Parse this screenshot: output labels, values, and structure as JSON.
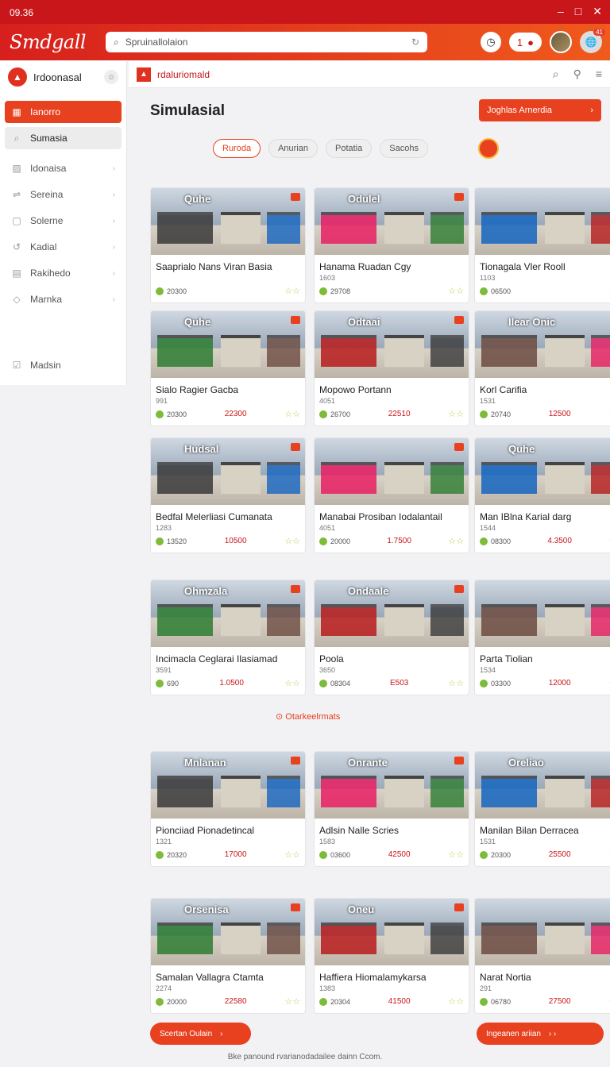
{
  "status": {
    "time": "09.36"
  },
  "app": {
    "name": "Smdgall",
    "search_placeholder": "Spruinallolaion"
  },
  "topbar": {
    "notif_count": "1",
    "avatar_badge": "41"
  },
  "sidebar": {
    "title": "Irdoonasal",
    "items": [
      {
        "label": "Ianorro",
        "icon": "grid-icon"
      },
      {
        "label": "Sumasia",
        "icon": "search-icon"
      },
      {
        "label": "Idonaisa",
        "icon": "image-icon"
      },
      {
        "label": "Sereina",
        "icon": "share-icon"
      },
      {
        "label": "Solerne",
        "icon": "page-icon"
      },
      {
        "label": "Kadial",
        "icon": "refresh-icon"
      },
      {
        "label": "Rakihedo",
        "icon": "calendar-icon"
      },
      {
        "label": "Marnka",
        "icon": "tag-icon"
      },
      {
        "label": "Madsin",
        "icon": "checklist-icon"
      }
    ]
  },
  "main": {
    "tab_title": "rdaluriomald",
    "page_title": "Simulasial",
    "cta_label": "Joghlas Arnerdia",
    "filters": [
      "Ruroda",
      "Anurian",
      "Potatia",
      "Sacohs"
    ],
    "section_label": "Otarkeelrmats",
    "prev_label": "Scertan Oulain",
    "next_label": "Ingeanen ariian",
    "footer": "Bke panound rvarianodadailee dainn Ccom."
  },
  "cards": [
    {
      "name": "Saaprialo Nans Viran Basia",
      "meta": "",
      "stat": "20300",
      "price": "",
      "brand": "Quhe"
    },
    {
      "name": "Hanama Ruadan Cgy",
      "meta": "1603",
      "stat": "29708",
      "price": "",
      "brand": "Odulel"
    },
    {
      "name": "Tionagala Vler Rooll",
      "meta": "1103",
      "stat": "06500",
      "price": "",
      "brand": ""
    },
    {
      "name": "Sialo Ragier Gacba",
      "meta": "991",
      "stat": "20300",
      "price": "22300",
      "brand": "Quhe"
    },
    {
      "name": "Mopowo Portann",
      "meta": "4051",
      "stat": "26700",
      "price": "22510",
      "brand": "Odtaai"
    },
    {
      "name": "Korl Carifia",
      "meta": "1531",
      "stat": "20740",
      "price": "12500",
      "brand": "Ilear Onic"
    },
    {
      "name": "Bedfal Melerliasi Cumanata",
      "meta": "1283",
      "stat": "13520",
      "price": "10500",
      "brand": "Hudsal"
    },
    {
      "name": "Manabai Prosiban Iodalantail",
      "meta": "4051",
      "stat": "20000",
      "price": "1.7500",
      "brand": ""
    },
    {
      "name": "Man IBlna Karial darg",
      "meta": "1544",
      "stat": "08300",
      "price": "4.3500",
      "brand": "Quhe"
    },
    {
      "name": "Incimacla Ceglarai Ilasiamad",
      "meta": "3591",
      "stat": "690",
      "price": "1.0500",
      "brand": "Ohmzala"
    },
    {
      "name": "Poola",
      "meta": "3650",
      "stat": "08304",
      "price": "E503",
      "brand": "Ondaale"
    },
    {
      "name": "Parta Tiolian",
      "meta": "1534",
      "stat": "03300",
      "price": "12000",
      "brand": ""
    },
    {
      "name": "Pionciiad Pionadetincal",
      "meta": "1321",
      "stat": "20320",
      "price": "17000",
      "brand": "Mnlanan"
    },
    {
      "name": "Adlsin Nalle Scries",
      "meta": "1583",
      "stat": "03600",
      "price": "42500",
      "brand": "Onrante"
    },
    {
      "name": "Manilan Bilan Derracea",
      "meta": "1531",
      "stat": "20300",
      "price": "25500",
      "brand": "Oreliao"
    },
    {
      "name": "Samalan Vallagra Ctamta",
      "meta": "2274",
      "stat": "20000",
      "price": "22580",
      "brand": "Orsenisa"
    },
    {
      "name": "Haffiera Hiomalamykarsa",
      "meta": "1383",
      "stat": "20304",
      "price": "41500",
      "brand": "Oneu"
    },
    {
      "name": "Narat Nortia",
      "meta": "291",
      "stat": "06780",
      "price": "27500",
      "brand": ""
    }
  ]
}
